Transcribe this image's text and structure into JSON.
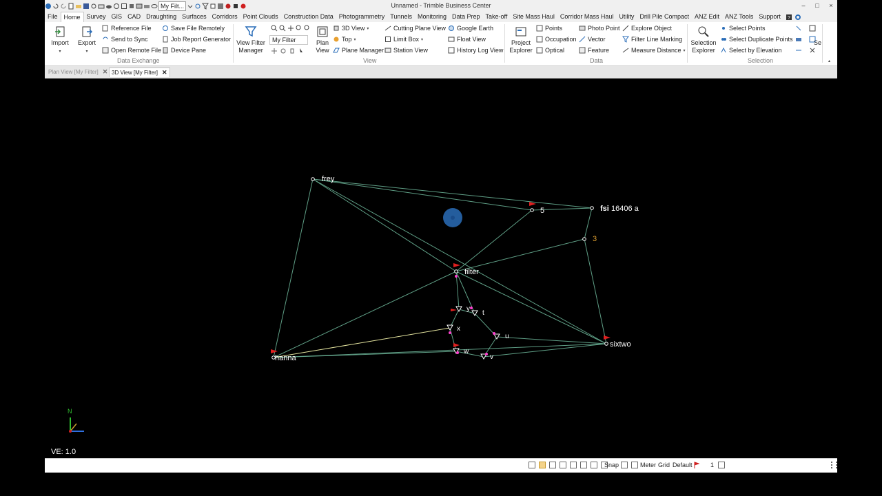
{
  "window": {
    "title": "Unnamed - Trimble Business Center",
    "filter_combo": "My Filt...",
    "controls": [
      "–",
      "□",
      "×"
    ]
  },
  "menu": [
    "File",
    "Home",
    "Survey",
    "GIS",
    "CAD",
    "Draughting",
    "Surfaces",
    "Corridors",
    "Point Clouds",
    "Construction Data",
    "Photogrammetry",
    "Tunnels",
    "Monitoring",
    "Data Prep",
    "Take-off",
    "Site Mass Haul",
    "Corridor Mass Haul",
    "Utility",
    "Drill Pile Compact",
    "ANZ Edit",
    "ANZ Tools",
    "Support"
  ],
  "ribbon": {
    "data_exchange": {
      "label": "Data Exchange",
      "import": "Import",
      "export": "Export",
      "items": [
        "Reference File",
        "Send to Sync",
        "Open Remote File",
        "Save File Remotely",
        "Job Report Generator",
        "Device Pane"
      ]
    },
    "view": {
      "label": "View",
      "view_filter_manager": [
        "View Filter",
        "Manager"
      ],
      "filter_name": "My Filter",
      "plan_view": [
        "Plan",
        "View"
      ],
      "items": [
        "3D View",
        "Top",
        "Plane Manager",
        "Cutting Plane View",
        "Limit Box",
        "Station View",
        "Google Earth",
        "Float View",
        "History Log View"
      ]
    },
    "data": {
      "label": "Data",
      "project_explorer": [
        "Project",
        "Explorer"
      ],
      "items": [
        "Points",
        "Occupation",
        "Optical",
        "Photo Point",
        "Vector",
        "Feature",
        "Explore Object",
        "Filter Line Marking",
        "Measure Distance"
      ]
    },
    "selection": {
      "label": "Selection",
      "selection_explorer": [
        "Selection",
        "Explorer"
      ],
      "items": [
        "Select Points",
        "Select Duplicate Points",
        "Select by Elevation"
      ],
      "cut": "Se"
    }
  },
  "tabs": [
    {
      "label": "Plan View [My Filter]",
      "active": false
    },
    {
      "label": "3D View [My Filter]",
      "active": true
    }
  ],
  "viewport": {
    "points": [
      {
        "id": "frey",
        "label": "frey",
        "color": "#ffffff"
      },
      {
        "id": "p5",
        "label": "5",
        "color": "#ffffff"
      },
      {
        "id": "fsi",
        "label_bold": "fsi",
        "label": "16406 a",
        "color": "#ffffff"
      },
      {
        "id": "p3",
        "label": "3",
        "color": "#e0a030"
      },
      {
        "id": "filter",
        "label": "filter",
        "color": "#ffffff"
      },
      {
        "id": "y",
        "label": "y",
        "color": "#ffffff"
      },
      {
        "id": "t",
        "label": "t",
        "color": "#ffffff"
      },
      {
        "id": "x",
        "label": "x",
        "color": "#ffffff"
      },
      {
        "id": "u",
        "label": "u",
        "color": "#ffffff"
      },
      {
        "id": "w",
        "label": "w",
        "color": "#ffffff"
      },
      {
        "id": "v",
        "label": "v",
        "color": "#ffffff"
      },
      {
        "id": "sixtwo",
        "label": "sixtwo",
        "color": "#ffffff"
      },
      {
        "id": "hanna",
        "label": "hanna",
        "color": "#ffffff"
      }
    ],
    "north_label": "N",
    "ve_label": "VE: 1.0",
    "line_color": "#5f9f86",
    "highlight_line_color": "#e6e6a0",
    "flag_color": "#e02020",
    "cursor_color": "#2a6db8"
  },
  "status": {
    "snap": "Snap",
    "units": "Meter",
    "grid": "Grid",
    "default": "Default",
    "page": "1"
  }
}
